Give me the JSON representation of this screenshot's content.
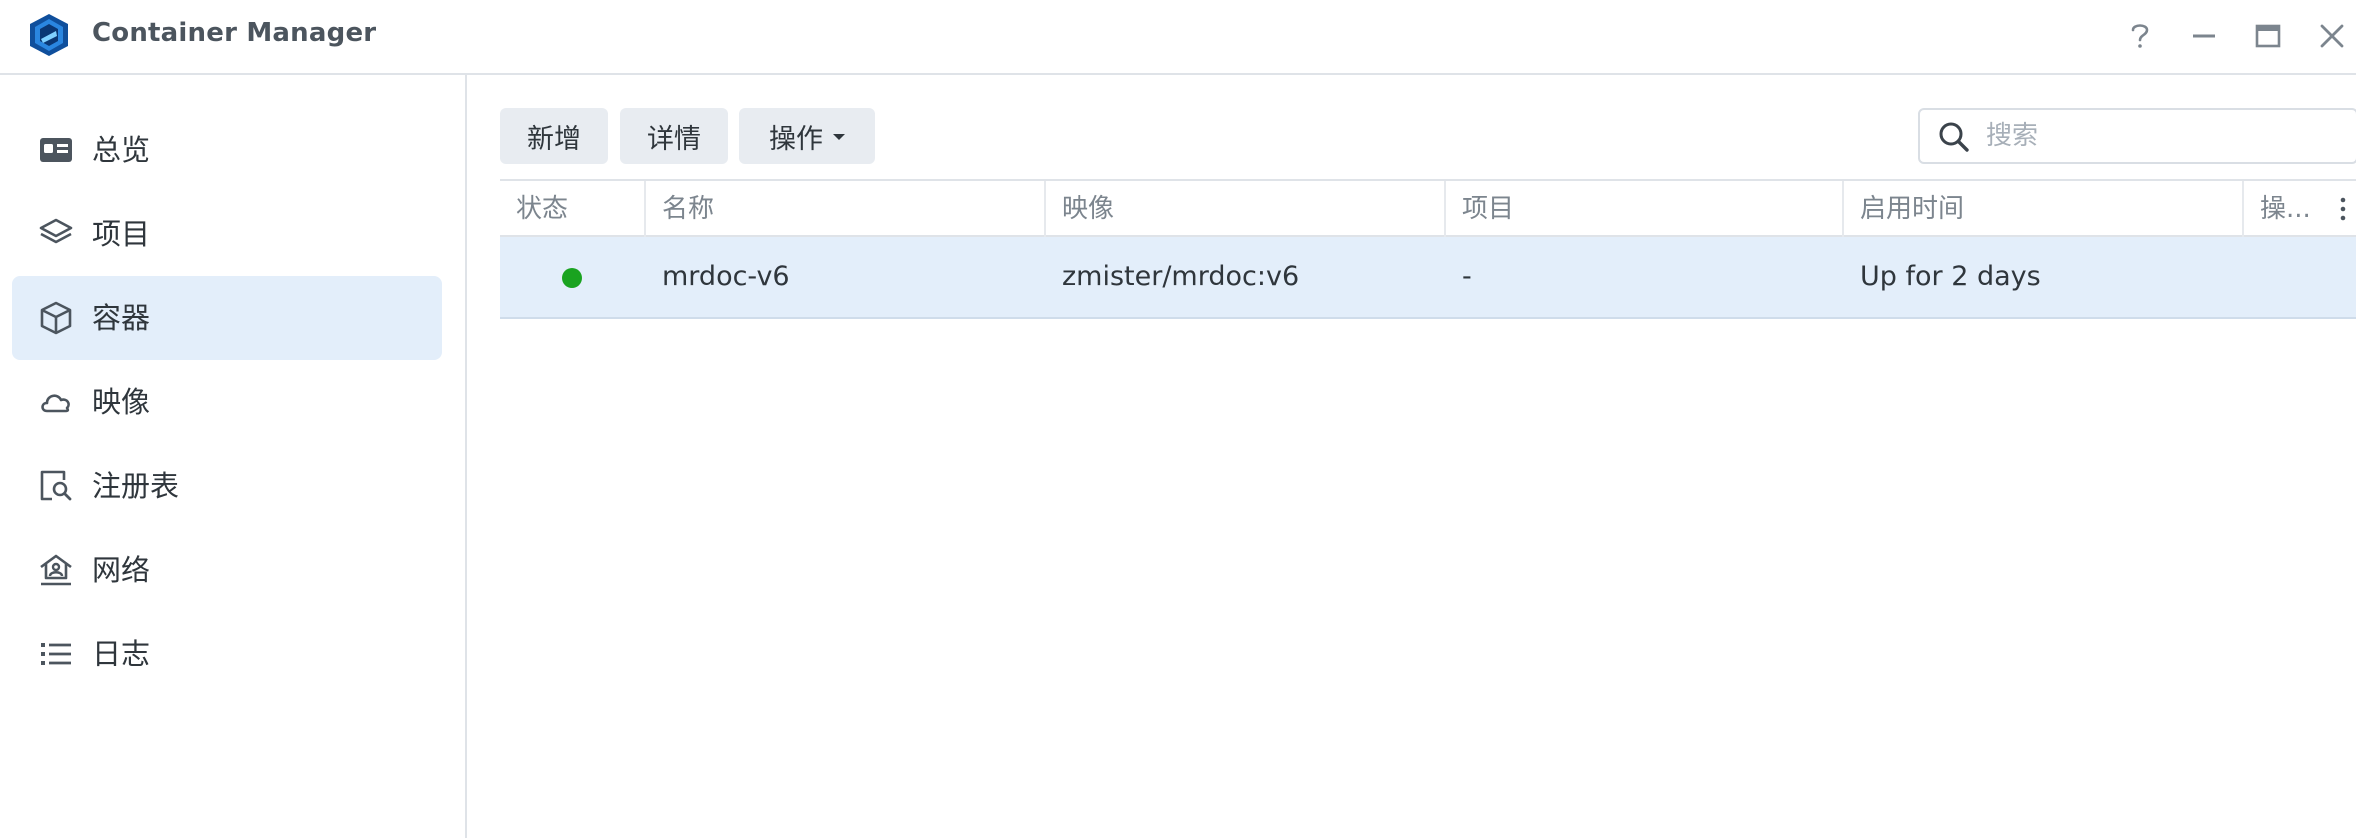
{
  "app": {
    "title": "Container Manager"
  },
  "window_controls": {
    "help_icon": "question-mark",
    "minimize_icon": "minus",
    "maximize_icon": "square",
    "close_icon": "x"
  },
  "sidebar": {
    "items": [
      {
        "label": "总览",
        "icon": "overview-card-icon",
        "active": false
      },
      {
        "label": "项目",
        "icon": "layers-icon",
        "active": false
      },
      {
        "label": "容器",
        "icon": "cube-icon",
        "active": true
      },
      {
        "label": "映像",
        "icon": "cloud-icon",
        "active": false
      },
      {
        "label": "注册表",
        "icon": "registry-search-icon",
        "active": false
      },
      {
        "label": "网络",
        "icon": "network-home-icon",
        "active": false
      },
      {
        "label": "日志",
        "icon": "list-icon",
        "active": false
      }
    ]
  },
  "toolbar": {
    "add_label": "新增",
    "detail_label": "详情",
    "action_label": "操作",
    "search_placeholder": "搜索",
    "search_value": ""
  },
  "table": {
    "columns": [
      "状态",
      "名称",
      "映像",
      "项目",
      "启用时间",
      "操..."
    ],
    "rows": [
      {
        "status": "running",
        "status_color": "#1aa320",
        "name": "mrdoc-v6",
        "image": "zmister/mrdoc:v6",
        "project": "-",
        "uptime": "Up for 2 days",
        "actions": ""
      }
    ]
  },
  "colors": {
    "accent_selected_bg": "#e3eefa",
    "button_bg": "#e8ecf1",
    "status_running": "#1aa320",
    "logo_blue": "#1f6fc4"
  }
}
